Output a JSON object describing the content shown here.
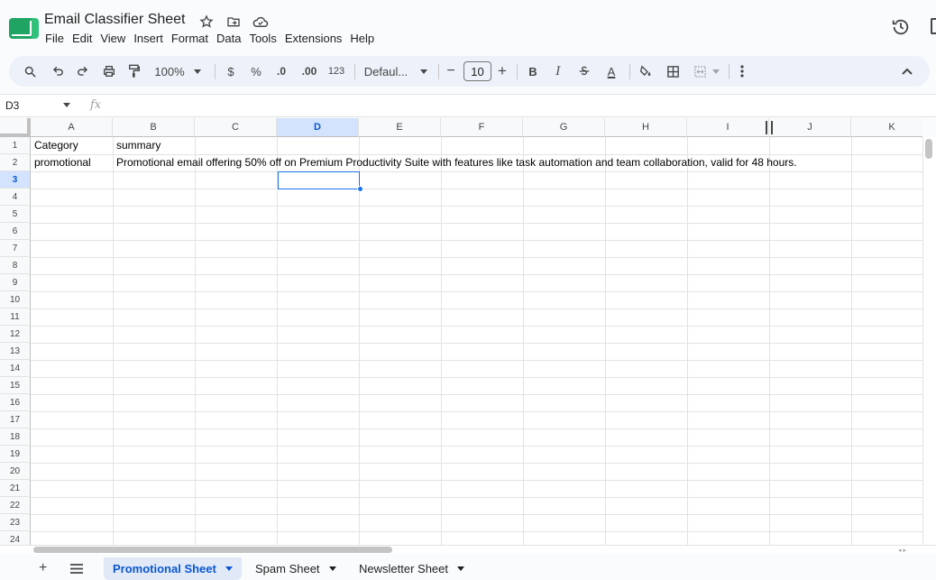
{
  "app": {
    "title": "Email Classifier Sheet"
  },
  "menu": [
    "File",
    "Edit",
    "View",
    "Insert",
    "Format",
    "Data",
    "Tools",
    "Extensions",
    "Help"
  ],
  "toolbar": {
    "zoom": "100%",
    "currency": "$",
    "percent": "%",
    "decrease_decimal": ".0",
    "increase_decimal": ".00",
    "number_format": "123",
    "font": "Defaul...",
    "font_size_minus": "−",
    "font_size": "10",
    "font_size_plus": "+",
    "bold": "B",
    "italic": "I",
    "text_color": "A"
  },
  "formula_bar": {
    "cell_ref": "D3",
    "fx": "fx"
  },
  "columns": [
    "A",
    "B",
    "C",
    "D",
    "E",
    "F",
    "G",
    "H",
    "I",
    "J",
    "K"
  ],
  "rows": [
    "1",
    "2",
    "3",
    "4",
    "5",
    "6",
    "7",
    "8",
    "9",
    "10",
    "11",
    "12",
    "13",
    "14",
    "15",
    "16",
    "17",
    "18",
    "19",
    "20",
    "21",
    "22",
    "23",
    "24"
  ],
  "cells": {
    "A1": "Category",
    "B1": "summary",
    "A2": "promotional",
    "B2": "Promotional email offering 50% off on Premium Productivity Suite with features like task automation and team collaboration, valid for 48 hours."
  },
  "active_cell": "D3",
  "sheets": [
    {
      "name": "Promotional Sheet",
      "active": true
    },
    {
      "name": "Spam Sheet",
      "active": false
    },
    {
      "name": "Newsletter Sheet",
      "active": false
    }
  ],
  "icons": {
    "star": "star-icon",
    "move": "move-to-folder-icon",
    "cloud": "cloud-status-icon",
    "history": "version-history-icon",
    "search": "search-icon",
    "undo": "undo-icon",
    "redo": "redo-icon",
    "print": "print-icon",
    "paint_format": "paint-format-icon",
    "strikethrough": "strikethrough-icon",
    "fill_color": "fill-color-icon",
    "borders": "borders-icon",
    "merge": "merge-cells-icon",
    "more": "more-vertical-icon",
    "collapse": "chevron-up-icon"
  },
  "colors": {
    "accent": "#0b57d0",
    "selection": "#1a73e8",
    "brand": "#1fa463"
  }
}
